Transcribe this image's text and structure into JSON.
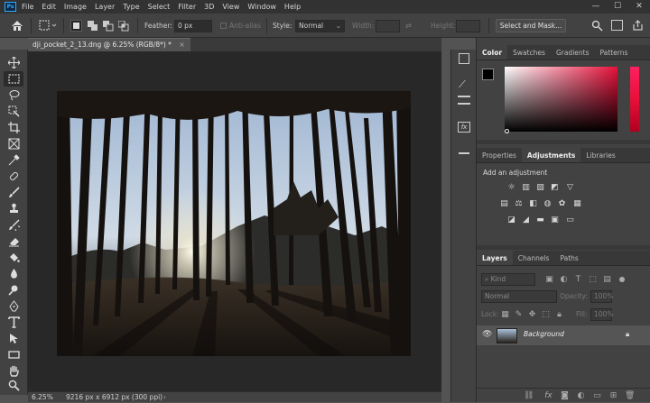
{
  "menubar": {
    "logo": "Ps",
    "items": [
      "File",
      "Edit",
      "Image",
      "Layer",
      "Type",
      "Select",
      "Filter",
      "3D",
      "View",
      "Window",
      "Help"
    ],
    "window_controls": [
      "—",
      "☐",
      "✕"
    ]
  },
  "options": {
    "feather_label": "Feather:",
    "feather_value": "0 px",
    "antialias_label": "Anti-alias",
    "style_label": "Style:",
    "style_value": "Normal",
    "width_label": "Width:",
    "height_label": "Height:",
    "select_mask_label": "Select and Mask..."
  },
  "document": {
    "tab_title": "dji_pocket_2_13.dng @ 6.25% (RGB/8*) *",
    "close": "×"
  },
  "status": {
    "zoom": "6.25%",
    "info": "9216 px x 6912 px (300 ppi)",
    "arrow": "›"
  },
  "color_panel": {
    "tabs": [
      "Color",
      "Swatches",
      "Gradients",
      "Patterns"
    ],
    "active": "Color",
    "hue_color": "#e8103a"
  },
  "adjust_panel": {
    "tabs": [
      "Properties",
      "Adjustments",
      "Libraries"
    ],
    "active": "Adjustments",
    "heading": "Add an adjustment"
  },
  "layers_panel": {
    "tabs": [
      "Layers",
      "Channels",
      "Paths"
    ],
    "active": "Layers",
    "search_placeholder": "Kind",
    "blend_mode": "Normal",
    "opacity_label": "Opacity:",
    "opacity_value": "100%",
    "lock_label": "Lock:",
    "fill_label": "Fill:",
    "fill_value": "100%",
    "layer_name": "Background",
    "footer_fx": "fx"
  },
  "colors": {
    "accent": "#31a8ff",
    "panel_bg": "#424242",
    "canvas_bg": "#282828"
  }
}
